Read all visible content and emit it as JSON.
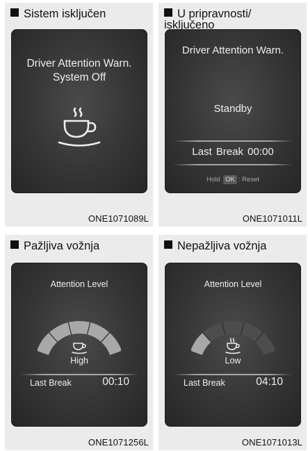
{
  "panels": [
    {
      "heading": "Sistem isključen",
      "title_line1": "Driver Attention Warn.",
      "title_line2": "System Off",
      "code": "ONE1071089L"
    },
    {
      "heading_line1": "U pripravnosti/",
      "heading_line2": "isključeno",
      "title": "Driver Attention Warn.",
      "status": "Standby",
      "last_break_label": "Last Break",
      "last_break_time": "00:00",
      "hint_hold": "Hold",
      "hint_ok": "OK",
      "hint_reset": ": Reset",
      "code": "ONE1071011L"
    },
    {
      "heading": "Pažljiva vožnja",
      "title": "Attention Level",
      "level": "High",
      "level_fraction": 1.0,
      "last_break_label": "Last Break",
      "last_break_time": "00:10",
      "code": "ONE1071256L"
    },
    {
      "heading": "Nepažljiva vožnja",
      "title": "Attention Level",
      "level": "Low",
      "level_fraction": 0.2,
      "last_break_label": "Last Break",
      "last_break_time": "04:10",
      "code": "ONE1071013L"
    }
  ],
  "icons": {
    "cup": "coffee-cup-icon",
    "bullet": "square-bullet-icon"
  },
  "colors": {
    "gauge_fill": "#a8a8a8",
    "gauge_track": "#4d4d4d",
    "screen_bg": "#333333",
    "panel_bg": "#ebebeb"
  }
}
